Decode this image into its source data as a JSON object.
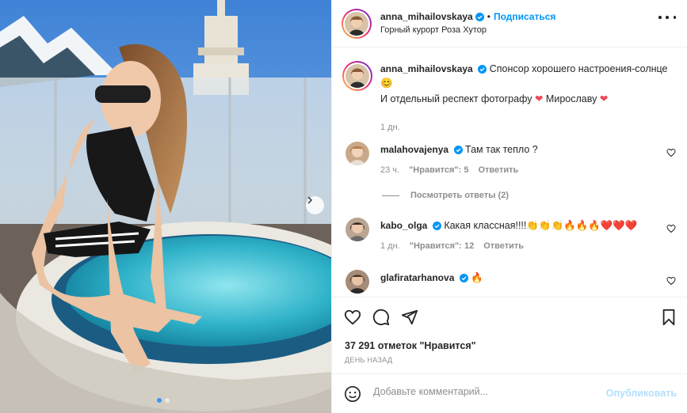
{
  "post": {
    "author": "anna_mihailovskaya",
    "follow_label": "Подписаться",
    "location": "Горный курорт Роза Хутор",
    "caption_line1": "Спонсор хорошего настроения-солнце",
    "caption_emoji1": "😊",
    "caption_line2a": "И отдельный респект фотографу",
    "caption_line2b": "Мирославу",
    "caption_heart": "❤",
    "caption_time": "1 дн.",
    "likes": "37 291 отметок \"Нравится\"",
    "date": "ДЕНЬ НАЗАД",
    "slide_count": 2,
    "active_slide": 1
  },
  "comments": [
    {
      "username": "malahovajenya",
      "text": "Там так тепло ?",
      "time": "23 ч.",
      "likes_label": "\"Нравится\": 5",
      "reply_label": "Ответить",
      "view_replies": "Посмотреть ответы (2)"
    },
    {
      "username": "kabo_olga",
      "text": "Какая классная!!!!👏👏👏🔥🔥🔥❤️❤️❤️",
      "time": "1 дн.",
      "likes_label": "\"Нравится\": 12",
      "reply_label": "Ответить"
    },
    {
      "username": "glafiratarhanova",
      "text": "🔥"
    }
  ],
  "composer": {
    "placeholder": "Добавьте комментарий...",
    "publish_label": "Опубликовать"
  },
  "colors": {
    "link_blue": "#0095f6",
    "verified_blue": "#0095f6",
    "heart_red": "#ed4956",
    "muted": "#8e8e8e"
  }
}
